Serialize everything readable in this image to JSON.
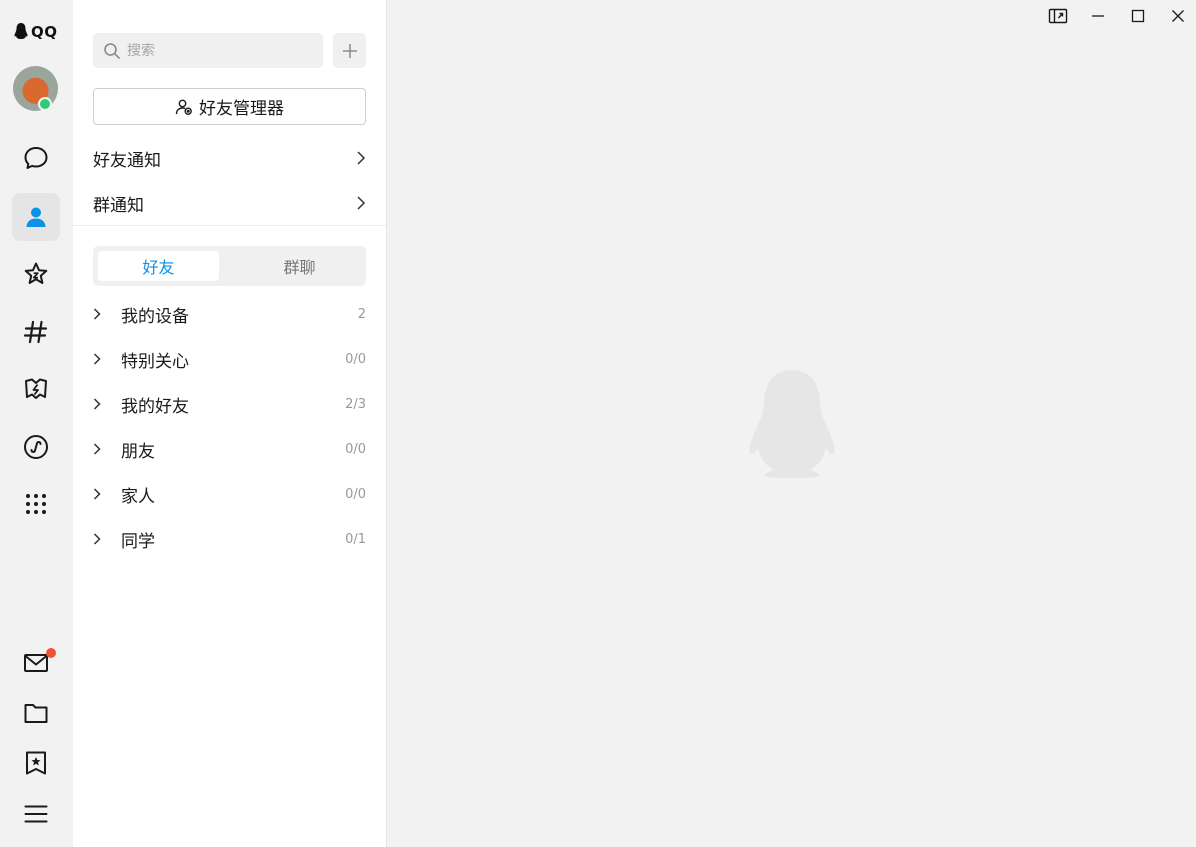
{
  "app": {
    "logo_text": "QQ"
  },
  "rail": {
    "items": [
      {
        "name": "messages-icon"
      },
      {
        "name": "contacts-icon",
        "active": true
      },
      {
        "name": "favorites-icon"
      },
      {
        "name": "channels-icon"
      },
      {
        "name": "games-icon"
      },
      {
        "name": "mini-apps-icon"
      },
      {
        "name": "apps-grid-icon"
      }
    ],
    "bottom": [
      {
        "name": "mail-icon",
        "badge": true
      },
      {
        "name": "folder-icon"
      },
      {
        "name": "bookmark-icon"
      },
      {
        "name": "menu-icon"
      }
    ],
    "badge_color": "#f0523a",
    "status_color": "#2ecc71"
  },
  "panel": {
    "search_placeholder": "搜索",
    "manager_label": "好友管理器",
    "friend_notice": "好友通知",
    "group_notice": "群通知",
    "tabs": [
      "好友",
      "群聊"
    ],
    "active_tab": 0,
    "groups": [
      {
        "name": "我的设备",
        "count": "2"
      },
      {
        "name": "特别关心",
        "count": "0/0"
      },
      {
        "name": "我的好友",
        "count": "2/3"
      },
      {
        "name": "朋友",
        "count": "0/0"
      },
      {
        "name": "家人",
        "count": "0/0"
      },
      {
        "name": "同学",
        "count": "0/1"
      }
    ]
  },
  "accent_color": "#0a92e6"
}
